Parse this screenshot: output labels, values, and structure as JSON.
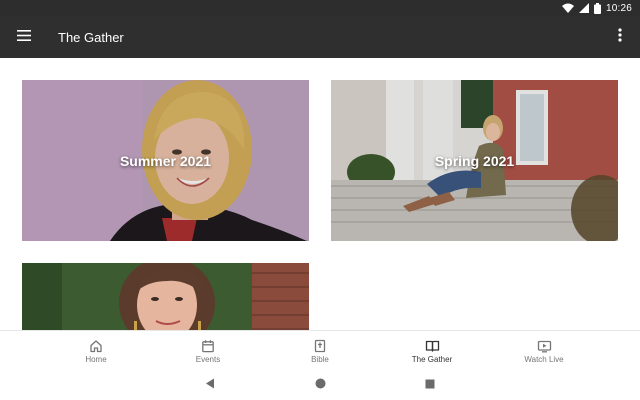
{
  "status_bar": {
    "time": "10:26",
    "icons": [
      "wifi-icon",
      "signal-icon",
      "battery-icon"
    ]
  },
  "app_bar": {
    "menu_icon": "menu-icon",
    "title": "The Gather",
    "overflow_icon": "more-vert-icon"
  },
  "cards": [
    {
      "title": "Summer 2021"
    },
    {
      "title": "Spring 2021"
    },
    {
      "title": ""
    }
  ],
  "bottom_nav": {
    "items": [
      {
        "label": "Home",
        "icon": "home-icon",
        "active": false
      },
      {
        "label": "Events",
        "icon": "calendar-icon",
        "active": false
      },
      {
        "label": "Bible",
        "icon": "bible-icon",
        "active": false
      },
      {
        "label": "The Gather",
        "icon": "book-open-icon",
        "active": true
      },
      {
        "label": "Watch Live",
        "icon": "live-tv-icon",
        "active": false
      }
    ]
  },
  "system_nav": {
    "buttons": [
      "back-icon",
      "home-circle-icon",
      "recents-icon"
    ]
  },
  "colors": {
    "app_bar": "#2f2f2f",
    "status_bar": "#2d2d2d",
    "active_nav": "#333333",
    "inactive_nav": "#757575"
  }
}
